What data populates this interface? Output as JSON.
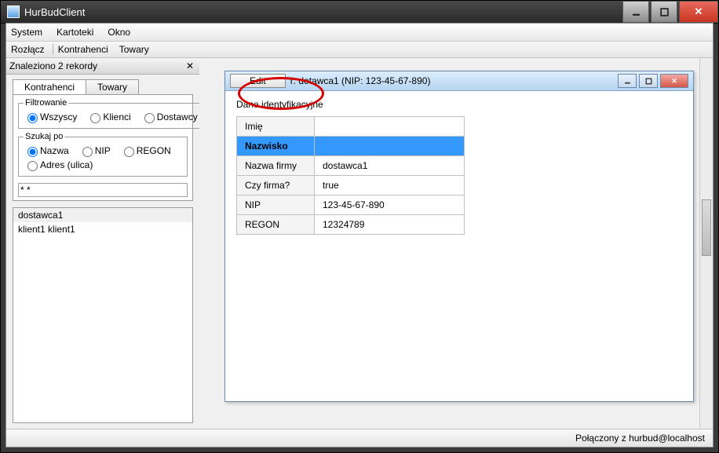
{
  "window": {
    "title": "HurBudClient"
  },
  "menu": {
    "items": [
      "System",
      "Kartoteki",
      "Okno"
    ]
  },
  "toolbar": {
    "items": [
      "Rozłącz",
      "Kontrahenci",
      "Towary"
    ]
  },
  "panel": {
    "header": "Znaleziono 2 rekordy",
    "tabs": [
      "Kontrahenci",
      "Towary"
    ],
    "filter_legend": "Filtrowanie",
    "filter_options": [
      "Wszyscy",
      "Klienci",
      "Dostawcy"
    ],
    "search_legend": "Szukaj po",
    "search_options": [
      "Nazwa",
      "NIP",
      "REGON",
      "Adres (ulica)"
    ],
    "search_value": "* *",
    "results": [
      "dostawca1",
      "klient1 klient1"
    ]
  },
  "child": {
    "edit_btn": "Edit",
    "title_fragment": "r: do",
    "title_rest": "tawca1  (NIP: 123-45-67-890)",
    "section": "Dane identyfikacyjne",
    "rows": [
      {
        "label": "Imię",
        "value": ""
      },
      {
        "label": "Nazwisko",
        "value": ""
      },
      {
        "label": "Nazwa firmy",
        "value": "dostawca1"
      },
      {
        "label": "Czy firma?",
        "value": "true"
      },
      {
        "label": "NIP",
        "value": "123-45-67-890"
      },
      {
        "label": "REGON",
        "value": "12324789"
      }
    ],
    "selected_row": 1
  },
  "status": {
    "text": "Połączony z hurbud@localhost"
  }
}
